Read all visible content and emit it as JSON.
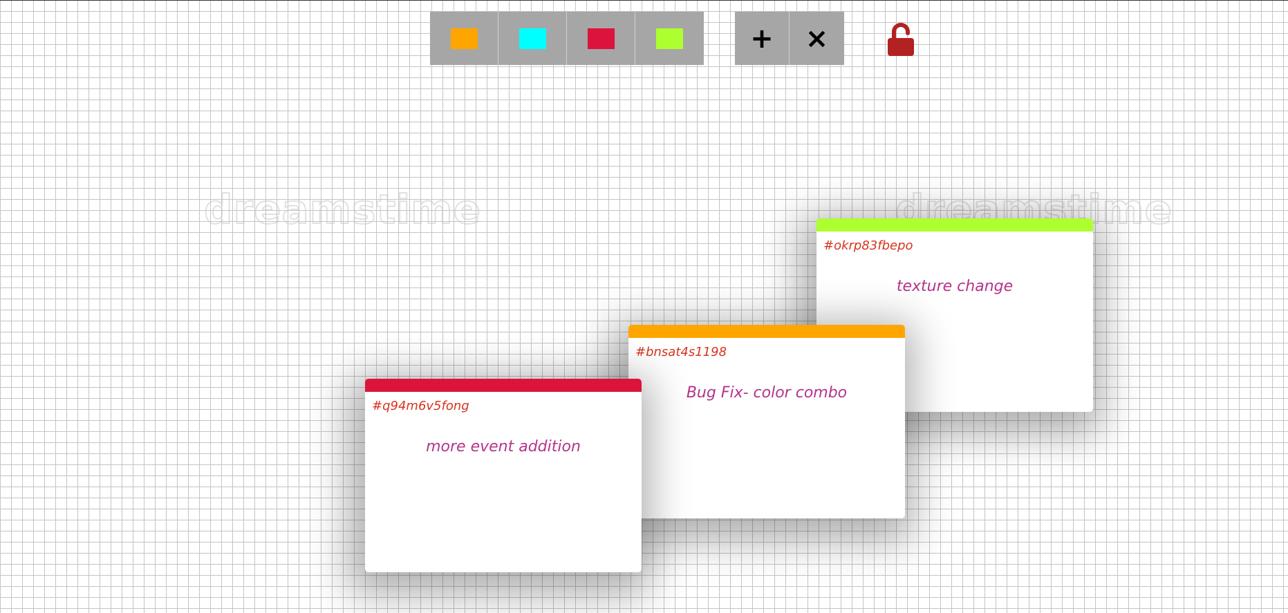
{
  "watermark": {
    "text": "dreamstime"
  },
  "palette": {
    "colors": [
      {
        "name": "orange",
        "hex": "#ffa500"
      },
      {
        "name": "cyan",
        "hex": "#00ffff"
      },
      {
        "name": "crimson",
        "hex": "#dc143c"
      },
      {
        "name": "green",
        "hex": "#adff2f"
      }
    ]
  },
  "actions": {
    "add_label": "+",
    "close_label": "×"
  },
  "lock": {
    "state": "unlocked",
    "color": "#b22222"
  },
  "tickets": [
    {
      "id": "#okrp83fbepo",
      "text": "texture change",
      "color": "#adff2f"
    },
    {
      "id": "#bnsat4s1198",
      "text": "Bug Fix- color combo",
      "color": "#ffa500"
    },
    {
      "id": "#q94m6v5fong",
      "text": "more event addition",
      "color": "#dc143c"
    }
  ]
}
